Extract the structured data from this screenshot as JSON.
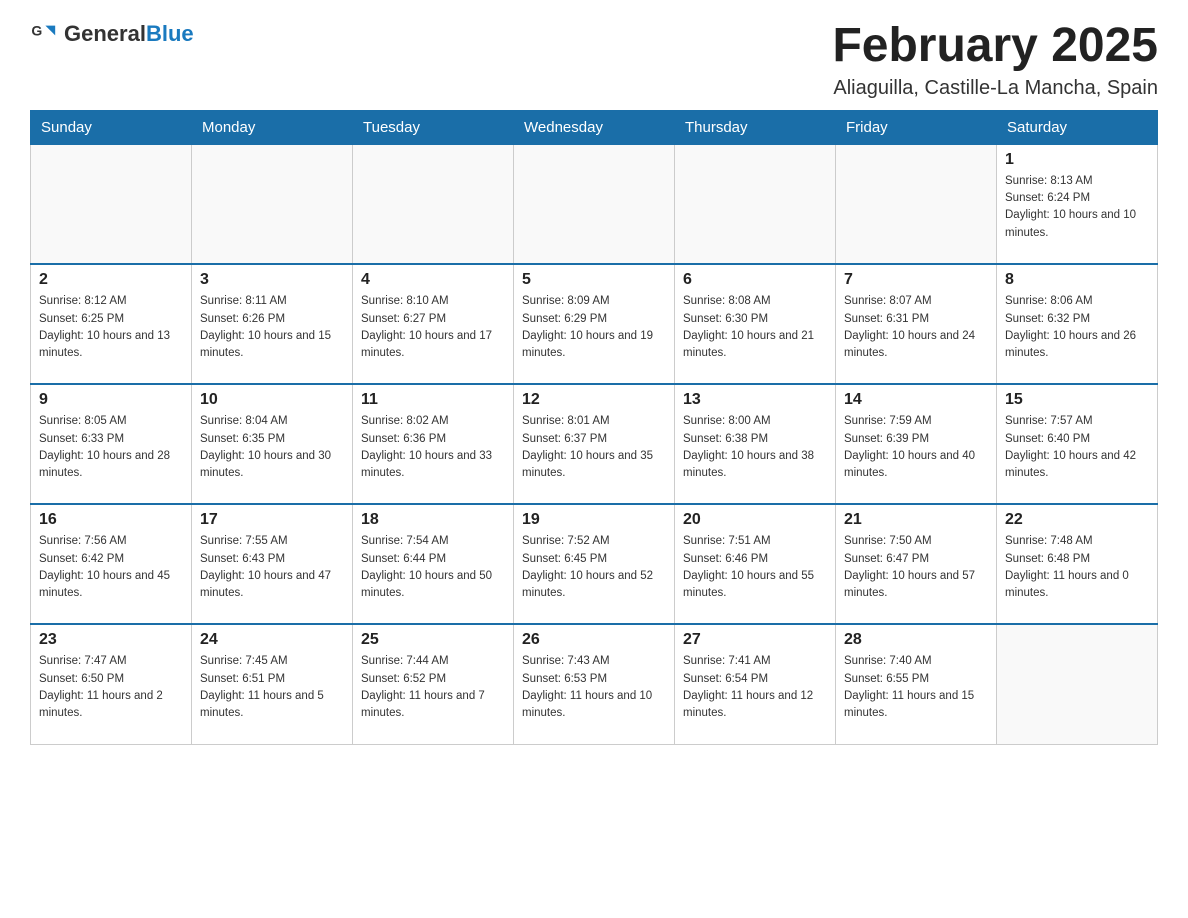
{
  "header": {
    "logo_general": "General",
    "logo_blue": "Blue",
    "month_year": "February 2025",
    "location": "Aliaguilla, Castille-La Mancha, Spain"
  },
  "days_of_week": [
    "Sunday",
    "Monday",
    "Tuesday",
    "Wednesday",
    "Thursday",
    "Friday",
    "Saturday"
  ],
  "weeks": [
    [
      {
        "day": "",
        "info": ""
      },
      {
        "day": "",
        "info": ""
      },
      {
        "day": "",
        "info": ""
      },
      {
        "day": "",
        "info": ""
      },
      {
        "day": "",
        "info": ""
      },
      {
        "day": "",
        "info": ""
      },
      {
        "day": "1",
        "info": "Sunrise: 8:13 AM\nSunset: 6:24 PM\nDaylight: 10 hours and 10 minutes."
      }
    ],
    [
      {
        "day": "2",
        "info": "Sunrise: 8:12 AM\nSunset: 6:25 PM\nDaylight: 10 hours and 13 minutes."
      },
      {
        "day": "3",
        "info": "Sunrise: 8:11 AM\nSunset: 6:26 PM\nDaylight: 10 hours and 15 minutes."
      },
      {
        "day": "4",
        "info": "Sunrise: 8:10 AM\nSunset: 6:27 PM\nDaylight: 10 hours and 17 minutes."
      },
      {
        "day": "5",
        "info": "Sunrise: 8:09 AM\nSunset: 6:29 PM\nDaylight: 10 hours and 19 minutes."
      },
      {
        "day": "6",
        "info": "Sunrise: 8:08 AM\nSunset: 6:30 PM\nDaylight: 10 hours and 21 minutes."
      },
      {
        "day": "7",
        "info": "Sunrise: 8:07 AM\nSunset: 6:31 PM\nDaylight: 10 hours and 24 minutes."
      },
      {
        "day": "8",
        "info": "Sunrise: 8:06 AM\nSunset: 6:32 PM\nDaylight: 10 hours and 26 minutes."
      }
    ],
    [
      {
        "day": "9",
        "info": "Sunrise: 8:05 AM\nSunset: 6:33 PM\nDaylight: 10 hours and 28 minutes."
      },
      {
        "day": "10",
        "info": "Sunrise: 8:04 AM\nSunset: 6:35 PM\nDaylight: 10 hours and 30 minutes."
      },
      {
        "day": "11",
        "info": "Sunrise: 8:02 AM\nSunset: 6:36 PM\nDaylight: 10 hours and 33 minutes."
      },
      {
        "day": "12",
        "info": "Sunrise: 8:01 AM\nSunset: 6:37 PM\nDaylight: 10 hours and 35 minutes."
      },
      {
        "day": "13",
        "info": "Sunrise: 8:00 AM\nSunset: 6:38 PM\nDaylight: 10 hours and 38 minutes."
      },
      {
        "day": "14",
        "info": "Sunrise: 7:59 AM\nSunset: 6:39 PM\nDaylight: 10 hours and 40 minutes."
      },
      {
        "day": "15",
        "info": "Sunrise: 7:57 AM\nSunset: 6:40 PM\nDaylight: 10 hours and 42 minutes."
      }
    ],
    [
      {
        "day": "16",
        "info": "Sunrise: 7:56 AM\nSunset: 6:42 PM\nDaylight: 10 hours and 45 minutes."
      },
      {
        "day": "17",
        "info": "Sunrise: 7:55 AM\nSunset: 6:43 PM\nDaylight: 10 hours and 47 minutes."
      },
      {
        "day": "18",
        "info": "Sunrise: 7:54 AM\nSunset: 6:44 PM\nDaylight: 10 hours and 50 minutes."
      },
      {
        "day": "19",
        "info": "Sunrise: 7:52 AM\nSunset: 6:45 PM\nDaylight: 10 hours and 52 minutes."
      },
      {
        "day": "20",
        "info": "Sunrise: 7:51 AM\nSunset: 6:46 PM\nDaylight: 10 hours and 55 minutes."
      },
      {
        "day": "21",
        "info": "Sunrise: 7:50 AM\nSunset: 6:47 PM\nDaylight: 10 hours and 57 minutes."
      },
      {
        "day": "22",
        "info": "Sunrise: 7:48 AM\nSunset: 6:48 PM\nDaylight: 11 hours and 0 minutes."
      }
    ],
    [
      {
        "day": "23",
        "info": "Sunrise: 7:47 AM\nSunset: 6:50 PM\nDaylight: 11 hours and 2 minutes."
      },
      {
        "day": "24",
        "info": "Sunrise: 7:45 AM\nSunset: 6:51 PM\nDaylight: 11 hours and 5 minutes."
      },
      {
        "day": "25",
        "info": "Sunrise: 7:44 AM\nSunset: 6:52 PM\nDaylight: 11 hours and 7 minutes."
      },
      {
        "day": "26",
        "info": "Sunrise: 7:43 AM\nSunset: 6:53 PM\nDaylight: 11 hours and 10 minutes."
      },
      {
        "day": "27",
        "info": "Sunrise: 7:41 AM\nSunset: 6:54 PM\nDaylight: 11 hours and 12 minutes."
      },
      {
        "day": "28",
        "info": "Sunrise: 7:40 AM\nSunset: 6:55 PM\nDaylight: 11 hours and 15 minutes."
      },
      {
        "day": "",
        "info": ""
      }
    ]
  ]
}
